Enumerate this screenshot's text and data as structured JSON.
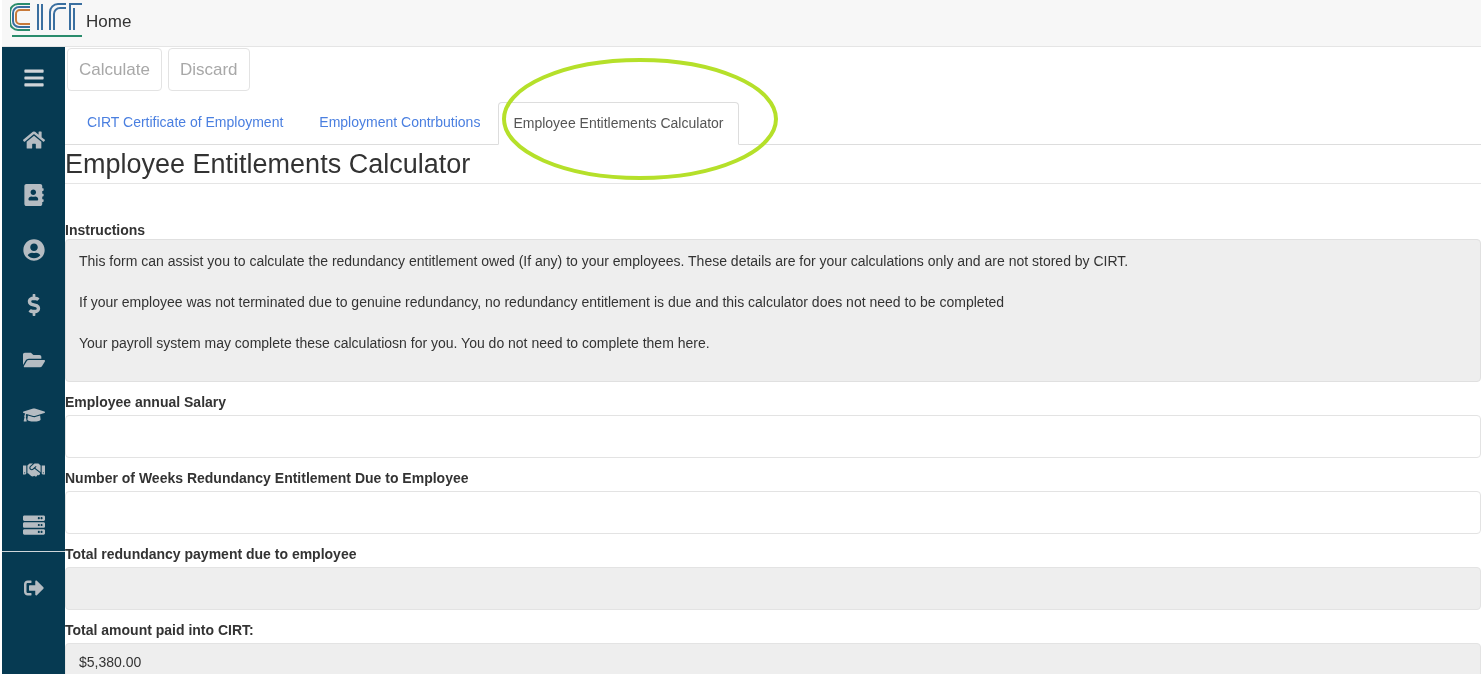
{
  "header": {
    "title": "Home"
  },
  "toolbar": {
    "buttons": [
      "Calculate",
      "Discard"
    ]
  },
  "tabs": [
    {
      "label": "CIRT Certificate of Employment",
      "selected": false
    },
    {
      "label": "Employment Contrbutions",
      "selected": false
    },
    {
      "label": "Employee Entitlements Calculator",
      "selected": true
    }
  ],
  "page_title": "Employee Entitlements Calculator",
  "instructions": {
    "label": "Instructions",
    "paragraphs": [
      "This form can assist you to calculate the redundancy entitlement owed (If any) to your employees. These details are for your calculations only and are not stored by CIRT.",
      "If your employee was not terminated due to genuine redundancy, no redundancy entitlement is due and this calculator does not need to be completed",
      "Your payroll system may complete these calculatiosn for you. You do not need to complete them here."
    ]
  },
  "fields": [
    {
      "label": "Employee annual Salary",
      "kind": "input"
    },
    {
      "label": "Number of Weeks Redundancy Entitlement Due to Employee",
      "kind": "input"
    },
    {
      "label": "Total redundancy payment due to employee",
      "kind": "readonly"
    },
    {
      "label": "Total amount paid into CIRT:",
      "kind": "readonly",
      "value": "$5,380.00"
    }
  ]
}
